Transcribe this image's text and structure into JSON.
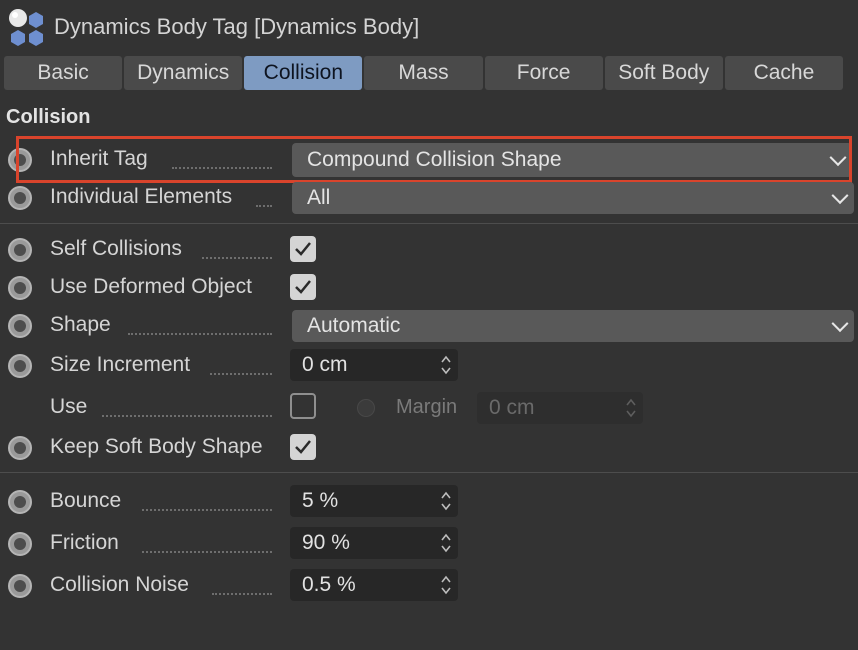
{
  "header": {
    "title": "Dynamics Body Tag [Dynamics Body]",
    "icon": "dynamics-body-tag-icon"
  },
  "tabs": [
    {
      "label": "Basic",
      "active": false
    },
    {
      "label": "Dynamics",
      "active": false
    },
    {
      "label": "Collision",
      "active": true
    },
    {
      "label": "Mass",
      "active": false
    },
    {
      "label": "Force",
      "active": false
    },
    {
      "label": "Soft Body",
      "active": false
    },
    {
      "label": "Cache",
      "active": false
    }
  ],
  "section": {
    "title": "Collision"
  },
  "fields": {
    "inherit_tag": {
      "label": "Inherit Tag",
      "value": "Compound Collision Shape"
    },
    "individual_elements": {
      "label": "Individual Elements",
      "value": "All"
    },
    "self_collisions": {
      "label": "Self Collisions",
      "checked": true
    },
    "use_deformed_object": {
      "label": "Use Deformed Object",
      "checked": true
    },
    "shape": {
      "label": "Shape",
      "value": "Automatic"
    },
    "size_increment": {
      "label": "Size Increment",
      "value": "0 cm"
    },
    "use": {
      "label": "Use",
      "checked": false
    },
    "margin": {
      "label": "Margin",
      "value": "0 cm"
    },
    "keep_soft_body_shape": {
      "label": "Keep Soft Body Shape",
      "checked": true
    },
    "bounce": {
      "label": "Bounce",
      "value": "5 %"
    },
    "friction": {
      "label": "Friction",
      "value": "90 %"
    },
    "collision_noise": {
      "label": "Collision Noise",
      "value": "0.5 %"
    }
  },
  "colors": {
    "background": "#333333",
    "active_tab": "#7e9bc2",
    "highlight": "#d9442c"
  }
}
